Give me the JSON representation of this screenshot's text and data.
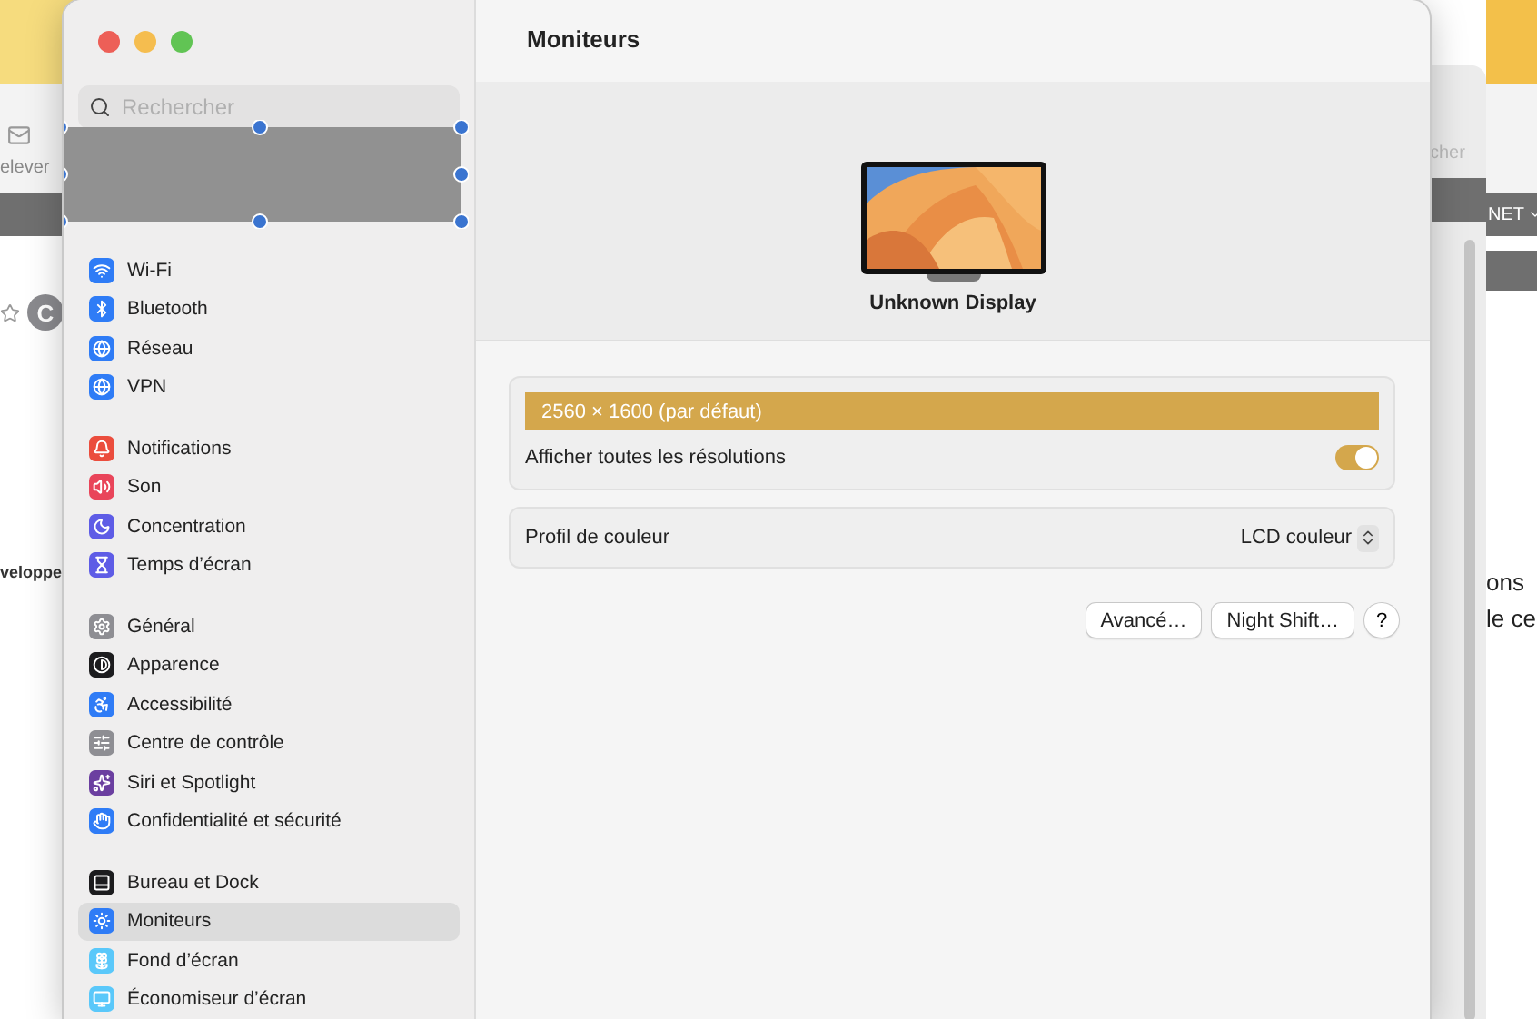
{
  "background_left": {
    "toolbar_label": "elever",
    "avatar": "C",
    "side_text": "veloppe"
  },
  "background_right": {
    "toolbar_label": "cher",
    "menu": "NET",
    "lines": [
      "ons",
      "le ce"
    ]
  },
  "window": {
    "title": "Moniteurs"
  },
  "search": {
    "placeholder": "Rechercher"
  },
  "sidebar": {
    "groups": [
      {
        "items": [
          {
            "label": "Wi-Fi",
            "kind": "wifi",
            "color": "#2f7cf6",
            "selected": false
          },
          {
            "label": "Bluetooth",
            "kind": "bluetooth",
            "color": "#2f7cf6",
            "selected": false
          },
          {
            "label": "Réseau",
            "kind": "globe",
            "color": "#2f7cf6",
            "selected": false
          },
          {
            "label": "VPN",
            "kind": "globe",
            "color": "#2f7cf6",
            "selected": false
          }
        ]
      },
      {
        "items": [
          {
            "label": "Notifications",
            "kind": "bell",
            "color": "#eb4d3d",
            "selected": false
          },
          {
            "label": "Son",
            "kind": "sound",
            "color": "#e9455a",
            "selected": false
          },
          {
            "label": "Concentration",
            "kind": "moon",
            "color": "#5e5ce6",
            "selected": false
          },
          {
            "label": "Temps d’écran",
            "kind": "hourglass",
            "color": "#5e5ce6",
            "selected": false
          }
        ]
      },
      {
        "items": [
          {
            "label": "Général",
            "kind": "gear",
            "color": "#8e8e93",
            "selected": false
          },
          {
            "label": "Apparence",
            "kind": "contrast",
            "color": "#1c1c1e",
            "selected": false
          },
          {
            "label": "Accessibilité",
            "kind": "accessibility",
            "color": "#2f7cf6",
            "selected": false
          },
          {
            "label": "Centre de contrôle",
            "kind": "sliders",
            "color": "#8e8e93",
            "selected": false
          },
          {
            "label": "Siri et Spotlight",
            "kind": "sparkles",
            "color": "#6b3fa0",
            "selected": false
          },
          {
            "label": "Confidentialité et sécurité",
            "kind": "hand",
            "color": "#2f7cf6",
            "selected": false
          }
        ]
      },
      {
        "items": [
          {
            "label": "Bureau et Dock",
            "kind": "dock",
            "color": "#1c1c1e",
            "selected": false
          },
          {
            "label": "Moniteurs",
            "kind": "sun",
            "color": "#2f7cf6",
            "selected": true
          },
          {
            "label": "Fond d’écran",
            "kind": "flower",
            "color": "#5ac8fa",
            "selected": false
          },
          {
            "label": "Économiseur d’écran",
            "kind": "monitor",
            "color": "#5ac8fa",
            "selected": false
          }
        ]
      }
    ]
  },
  "display": {
    "name": "Unknown Display"
  },
  "resolution": {
    "label": "2560 × 1600 (par défaut)",
    "selected": true
  },
  "show_all": {
    "label": "Afficher toutes les résolutions",
    "on": true
  },
  "color_profile": {
    "label": "Profil de couleur",
    "value": "LCD couleur"
  },
  "buttons": [
    "Avancé…",
    "Night Shift…"
  ],
  "help": "?"
}
